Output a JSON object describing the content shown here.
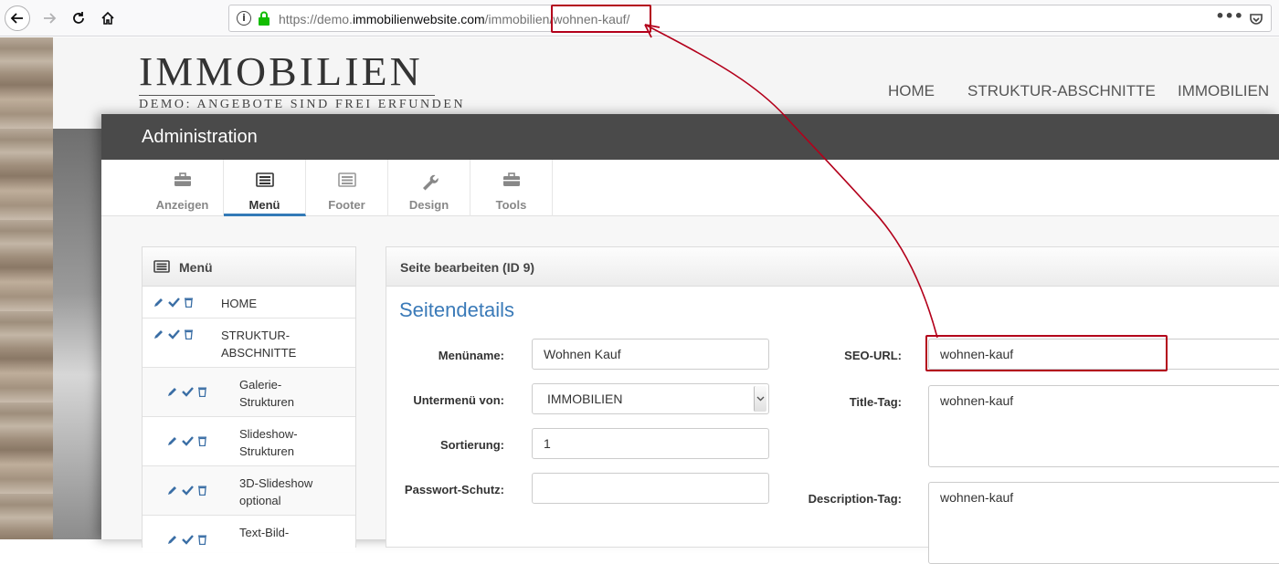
{
  "browser": {
    "url_prefix": "https://demo.",
    "url_domain": "immobilienwebsite.com",
    "url_path": "/immobilien/",
    "url_slug": "wohnen-kauf/",
    "more_label": "•••"
  },
  "site": {
    "logo_main": "IMMOBILIEN",
    "logo_sub": "DEMO: ANGEBOTE SIND FREI ERFUNDEN",
    "nav": [
      "HOME",
      "STRUKTUR-ABSCHNITTE",
      "IMMOBILIEN"
    ]
  },
  "admin": {
    "title": "Administration",
    "tabs": [
      {
        "label": "Anzeigen",
        "icon": "briefcase-icon"
      },
      {
        "label": "Menü",
        "icon": "list-icon"
      },
      {
        "label": "Footer",
        "icon": "list-icon"
      },
      {
        "label": "Design",
        "icon": "wrench-icon"
      },
      {
        "label": "Tools",
        "icon": "briefcase-icon"
      }
    ],
    "active_tab": "Menü"
  },
  "menu": {
    "title": "Menü",
    "items": [
      {
        "label": "HOME",
        "level": 0
      },
      {
        "label": "STRUKTUR-\nABSCHNITTE",
        "level": 0
      },
      {
        "label": "Galerie-\nStrukturen",
        "level": 1
      },
      {
        "label": "Slideshow-\nStrukturen",
        "level": 1
      },
      {
        "label": "3D-Slideshow\noptional",
        "level": 1
      },
      {
        "label": "Text-Bild-",
        "level": 1
      }
    ]
  },
  "editor": {
    "header": "Seite bearbeiten (ID 9)",
    "section_title": "Seitendetails",
    "fields": {
      "menuname_label": "Menüname:",
      "menuname_value": "Wohnen Kauf",
      "untermenu_label": "Untermenü von:",
      "untermenu_value": "IMMOBILIEN",
      "sortierung_label": "Sortierung:",
      "sortierung_value": "1",
      "passwort_label": "Passwort-Schutz:",
      "passwort_value": "",
      "seo_label": "SEO-URL:",
      "seo_value": "wohnen-kauf",
      "title_label": "Title-Tag:",
      "title_value": "wohnen-kauf",
      "description_label": "Description-Tag:",
      "description_value": "wohnen-kauf"
    }
  },
  "colors": {
    "accent": "#337ab7",
    "annotation": "#b3001b",
    "admin_header": "#4a4a4a",
    "action_icon": "#3a6ea5"
  }
}
